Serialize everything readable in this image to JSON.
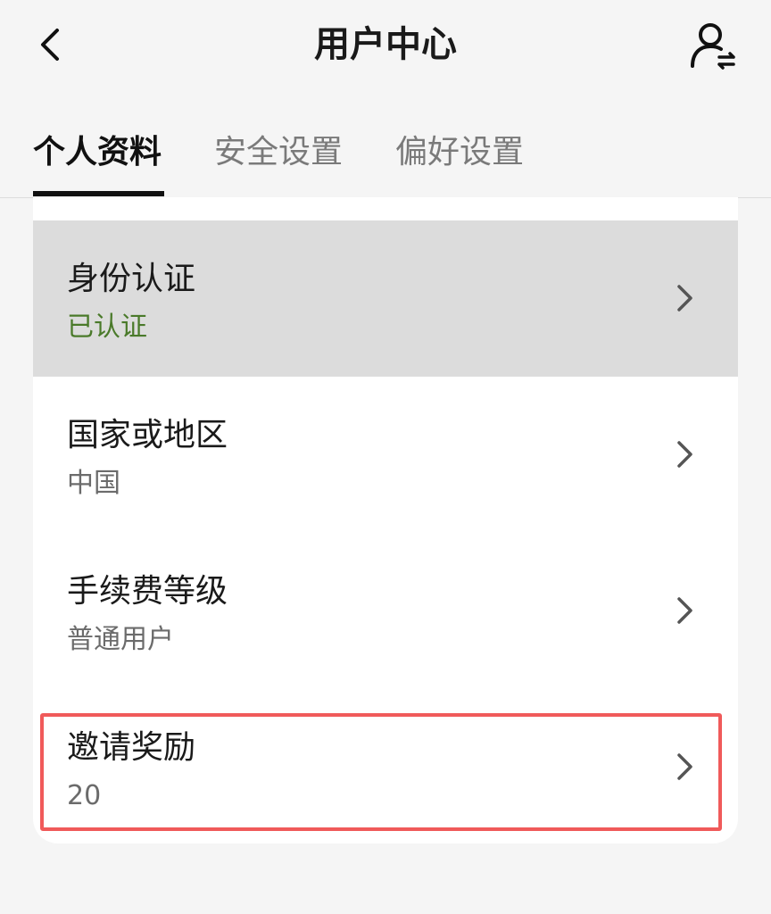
{
  "header": {
    "title": "用户中心",
    "back_icon": "chevron-left-icon",
    "switch_icon": "user-switch-icon"
  },
  "tabs": [
    {
      "label": "个人资料",
      "active": true
    },
    {
      "label": "安全设置",
      "active": false
    },
    {
      "label": "偏好设置",
      "active": false
    }
  ],
  "profile": {
    "items": [
      {
        "title": "身份认证",
        "value": "已认证",
        "highlighted": true
      },
      {
        "title": "国家或地区",
        "value": "中国",
        "highlighted": false
      },
      {
        "title": "手续费等级",
        "value": "普通用户",
        "highlighted": false
      },
      {
        "title": "邀请奖励",
        "value": "20",
        "highlighted": false
      }
    ]
  },
  "colors": {
    "verified_text": "#4a7a2a",
    "highlight_row": "#dcdcdc",
    "annotation_box": "#f05a5a"
  }
}
